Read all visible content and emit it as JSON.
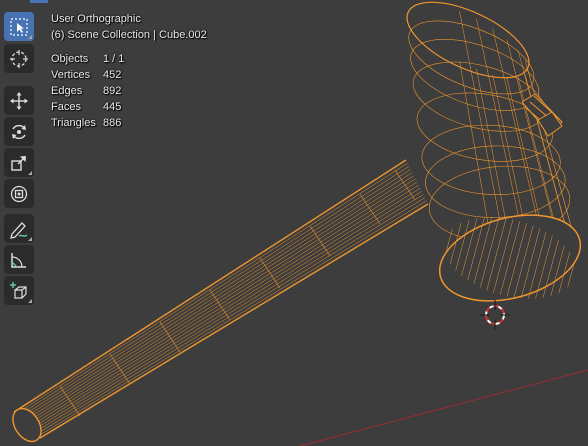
{
  "viewport": {
    "view_name": "User Orthographic",
    "collection_info": "(6) Scene Collection | Cube.002",
    "stats": [
      {
        "label": "Objects",
        "value": "1 / 1"
      },
      {
        "label": "Vertices",
        "value": "452"
      },
      {
        "label": "Edges",
        "value": "892"
      },
      {
        "label": "Faces",
        "value": "445"
      },
      {
        "label": "Triangles",
        "value": "886"
      }
    ]
  },
  "toolbar": {
    "tools": [
      {
        "name": "select-box",
        "active": true
      },
      {
        "name": "cursor",
        "active": false
      },
      {
        "name": "move",
        "active": false
      },
      {
        "name": "rotate",
        "active": false
      },
      {
        "name": "scale",
        "active": false
      },
      {
        "name": "transform",
        "active": false
      },
      {
        "name": "annotate",
        "active": false
      },
      {
        "name": "measure",
        "active": false
      },
      {
        "name": "add-cube",
        "active": false
      }
    ]
  },
  "colors": {
    "background": "#3d3d3d",
    "wireframe": "#f0962e",
    "x_axis": "#8a2f36",
    "active_tool": "#4772b3"
  }
}
